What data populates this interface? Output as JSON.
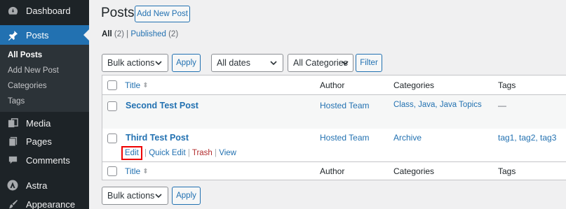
{
  "sidebar": {
    "items": [
      {
        "label": "Dashboard",
        "icon": "dashboard-icon"
      },
      {
        "label": "Posts",
        "icon": "pushpin-icon"
      },
      {
        "label": "Media",
        "icon": "media-icon"
      },
      {
        "label": "Pages",
        "icon": "pages-icon"
      },
      {
        "label": "Comments",
        "icon": "comments-icon"
      },
      {
        "label": "Astra",
        "icon": "astra-icon"
      },
      {
        "label": "Appearance",
        "icon": "brush-icon"
      }
    ],
    "submenu": [
      "All Posts",
      "Add New Post",
      "Categories",
      "Tags"
    ]
  },
  "header": {
    "title": "Posts",
    "add_new_label": "Add New Post"
  },
  "filters_nav": {
    "all_label": "All",
    "all_count": "(2)",
    "separator": "|",
    "published_label": "Published",
    "published_count": "(2)"
  },
  "toolbar": {
    "bulk_actions": "Bulk actions",
    "apply_label": "Apply",
    "dates": "All dates",
    "categories": "All Categories",
    "filter_label": "Filter"
  },
  "table": {
    "columns": [
      "Title",
      "Author",
      "Categories",
      "Tags"
    ],
    "rows": [
      {
        "title": "Second Test Post",
        "author": "Hosted Team",
        "categories": "Class, Java, Java Topics",
        "tags": "—"
      },
      {
        "title": "Third Test Post",
        "author": "Hosted Team",
        "categories": "Archive",
        "tags": "tag1, tag2, tag3"
      }
    ],
    "row_actions": {
      "edit": "Edit",
      "quick_edit": "Quick Edit",
      "trash": "Trash",
      "view": "View",
      "sep": "|"
    }
  },
  "colors": {
    "sidebar_bg": "#1d2327",
    "active_bg": "#2271b1",
    "link": "#2271b1",
    "trash": "#b32d2e",
    "highlight_border": "#ee0000"
  }
}
